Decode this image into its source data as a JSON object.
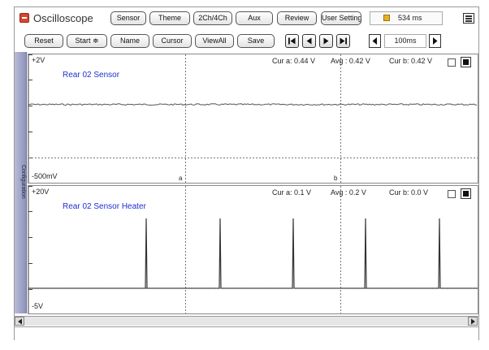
{
  "app": {
    "title": "Oscilloscope"
  },
  "toolbar": {
    "buttons": [
      "Sensor",
      "Theme",
      "2Ch/4Ch",
      "Aux",
      "Review",
      "User Setting"
    ],
    "time_display": "534 ms",
    "menu_icon": "hamburger-menu-icon"
  },
  "toolbar2": {
    "reset_label": "Reset",
    "start_label": "Start ≑",
    "name_label": "Name",
    "cursor_label": "Cursor",
    "viewall_label": "ViewAll",
    "save_label": "Save",
    "nav_icons": [
      "skip-first-icon",
      "step-back-icon",
      "step-forward-icon",
      "skip-last-icon"
    ],
    "interval_value": "100ms"
  },
  "sidebar": {
    "label": "Configuration"
  },
  "channels": [
    {
      "name": "Rear 02 Sensor",
      "y_max": "+2V",
      "y_min": "-500mV",
      "cursor_a": "Cur a: 0.44 V",
      "avg": "Avg : 0.42 V",
      "cursor_b": "Cur b: 0.42 V",
      "cursor_a_marker": "a",
      "cursor_b_marker": "b",
      "signal_level_fraction": 0.42
    },
    {
      "name": "Rear 02 Sensor Heater",
      "y_max": "+20V",
      "y_min": "-5V",
      "cursor_a": "Cur a: 0.1 V",
      "avg": "Avg : 0.2 V",
      "cursor_b": "Cur b: 0.0 V"
    }
  ]
}
